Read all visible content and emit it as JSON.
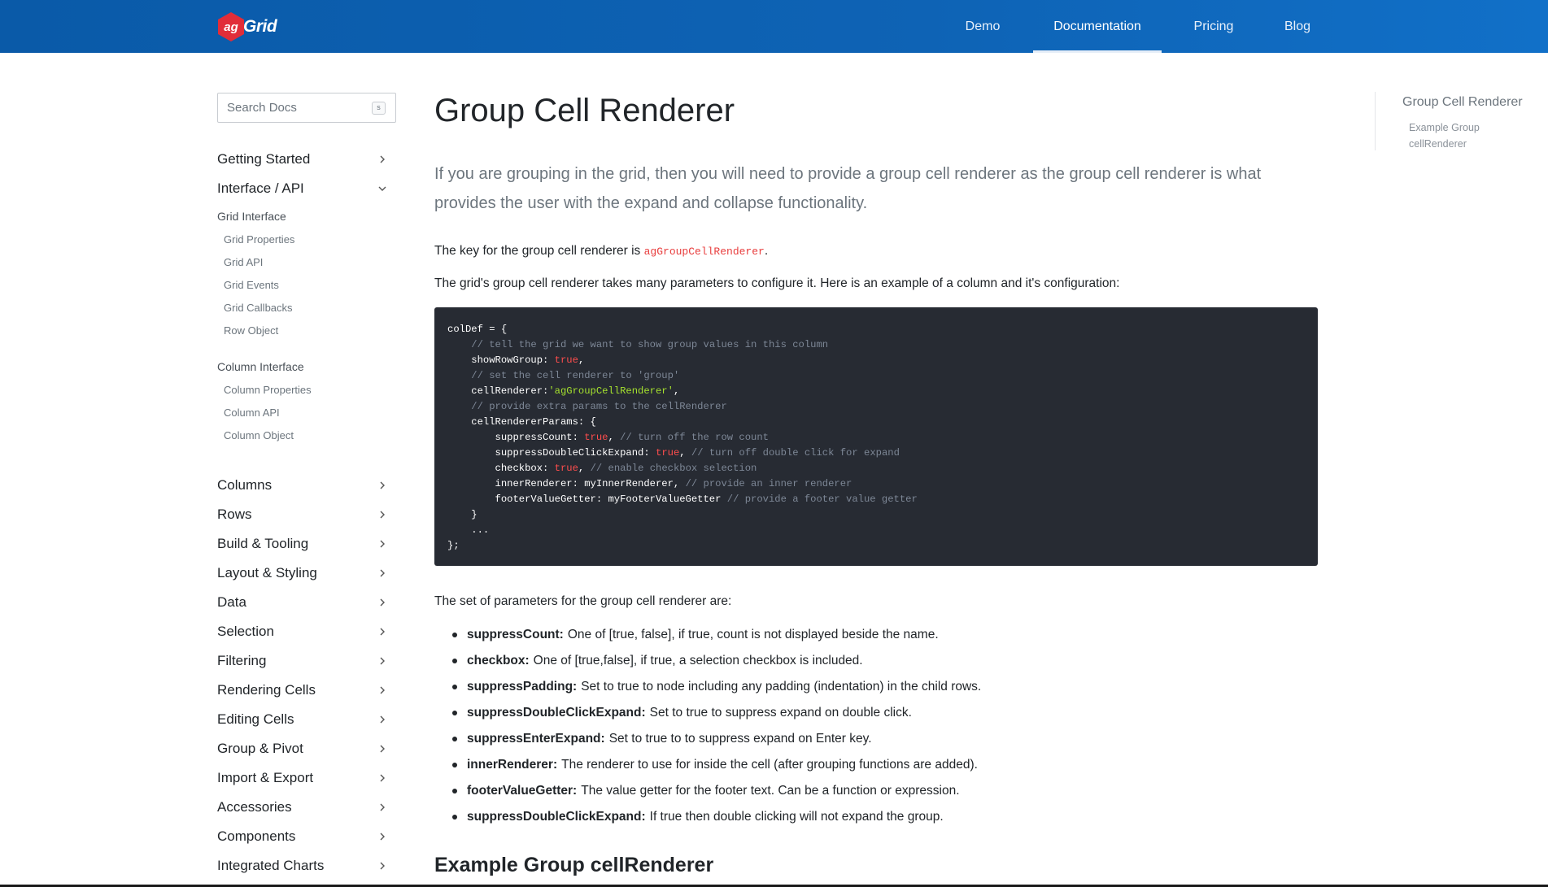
{
  "brand": {
    "logo_badge": "ag",
    "logo_text": "Grid",
    "badge_color": "#e12d39"
  },
  "nav": {
    "items": [
      {
        "label": "Demo"
      },
      {
        "label": "Documentation"
      },
      {
        "label": "Pricing"
      },
      {
        "label": "Blog"
      }
    ],
    "active": "Documentation"
  },
  "search": {
    "placeholder": "Search Docs",
    "shortcut": "s"
  },
  "sidebar": {
    "top_sections": [
      {
        "label": "Getting Started",
        "icon": "chevron-right-icon"
      },
      {
        "label": "Interface / API",
        "icon": "chevron-down-icon"
      }
    ],
    "interface_groups": [
      {
        "heading": "Grid Interface",
        "links": [
          "Grid Properties",
          "Grid API",
          "Grid Events",
          "Grid Callbacks",
          "Row Object"
        ]
      },
      {
        "heading": "Column Interface",
        "links": [
          "Column Properties",
          "Column API",
          "Column Object"
        ]
      }
    ],
    "sections": [
      "Columns",
      "Rows",
      "Build & Tooling",
      "Layout & Styling",
      "Data",
      "Selection",
      "Filtering",
      "Rendering Cells",
      "Editing Cells",
      "Group & Pivot",
      "Import & Export",
      "Accessories",
      "Components",
      "Integrated Charts"
    ]
  },
  "main": {
    "title": "Group Cell Renderer",
    "lead": "If you are grouping in the grid, then you will need to provide a group cell renderer as the group cell renderer is what provides the user with the expand and collapse functionality.",
    "key_prefix": "The key for the group cell renderer is ",
    "key_code": "agGroupCellRenderer",
    "key_suffix": ".",
    "config_intro": "The grid's group cell renderer takes many parameters to configure it. Here is an example of a column and it's configuration:",
    "code": {
      "l1": "colDef = {",
      "c1": "// tell the grid we want to show group values in this column",
      "l2a": "showRowGroup: ",
      "l2b": "true",
      "l2c": ",",
      "c2": "// set the cell renderer to 'group'",
      "l3a": "cellRenderer:",
      "l3b": "'agGroupCellRenderer'",
      "l3c": ",",
      "c3": "// provide extra params to the cellRenderer",
      "l4": "cellRendererParams: {",
      "l5a": "suppressCount: ",
      "l5b": "true",
      "l5c": ", ",
      "l5d": "// turn off the row count",
      "l6a": "suppressDoubleClickExpand: ",
      "l6b": "true",
      "l6c": ", ",
      "l6d": "// turn off double click for expand",
      "l7a": "checkbox: ",
      "l7b": "true",
      "l7c": ", ",
      "l7d": "// enable checkbox selection",
      "l8a": "innerRenderer: myInnerRenderer, ",
      "l8d": "// provide an inner renderer",
      "l9a": "footerValueGetter: myFooterValueGetter ",
      "l9d": "// provide a footer value getter",
      "l10": "}",
      "l11": "...",
      "l12": "};"
    },
    "params_intro": "The set of parameters for the group cell renderer are:",
    "params": [
      {
        "name": "suppressCount:",
        "desc": "One of [true, false], if true, count is not displayed beside the name."
      },
      {
        "name": "checkbox:",
        "desc": "One of [true,false], if true, a selection checkbox is included."
      },
      {
        "name": "suppressPadding:",
        "desc": "Set to true to node including any padding (indentation) in the child rows."
      },
      {
        "name": "suppressDoubleClickExpand:",
        "desc": "Set to true to suppress expand on double click."
      },
      {
        "name": "suppressEnterExpand:",
        "desc": "Set to true to to suppress expand on Enter key."
      },
      {
        "name": "innerRenderer:",
        "desc": "The renderer to use for inside the cell (after grouping functions are added)."
      },
      {
        "name": "footerValueGetter:",
        "desc": "The value getter for the footer text. Can be a function or expression."
      },
      {
        "name": "suppressDoubleClickExpand:",
        "desc": "If true then double clicking will not expand the group."
      }
    ],
    "example_heading": "Example Group cellRenderer"
  },
  "toc": {
    "title": "Group Cell Renderer",
    "sub": "Example Group cellRenderer"
  },
  "colors": {
    "nav_bg": "#0e63b5",
    "code_bg": "#272b33",
    "inline_code": "#e83e3e"
  }
}
